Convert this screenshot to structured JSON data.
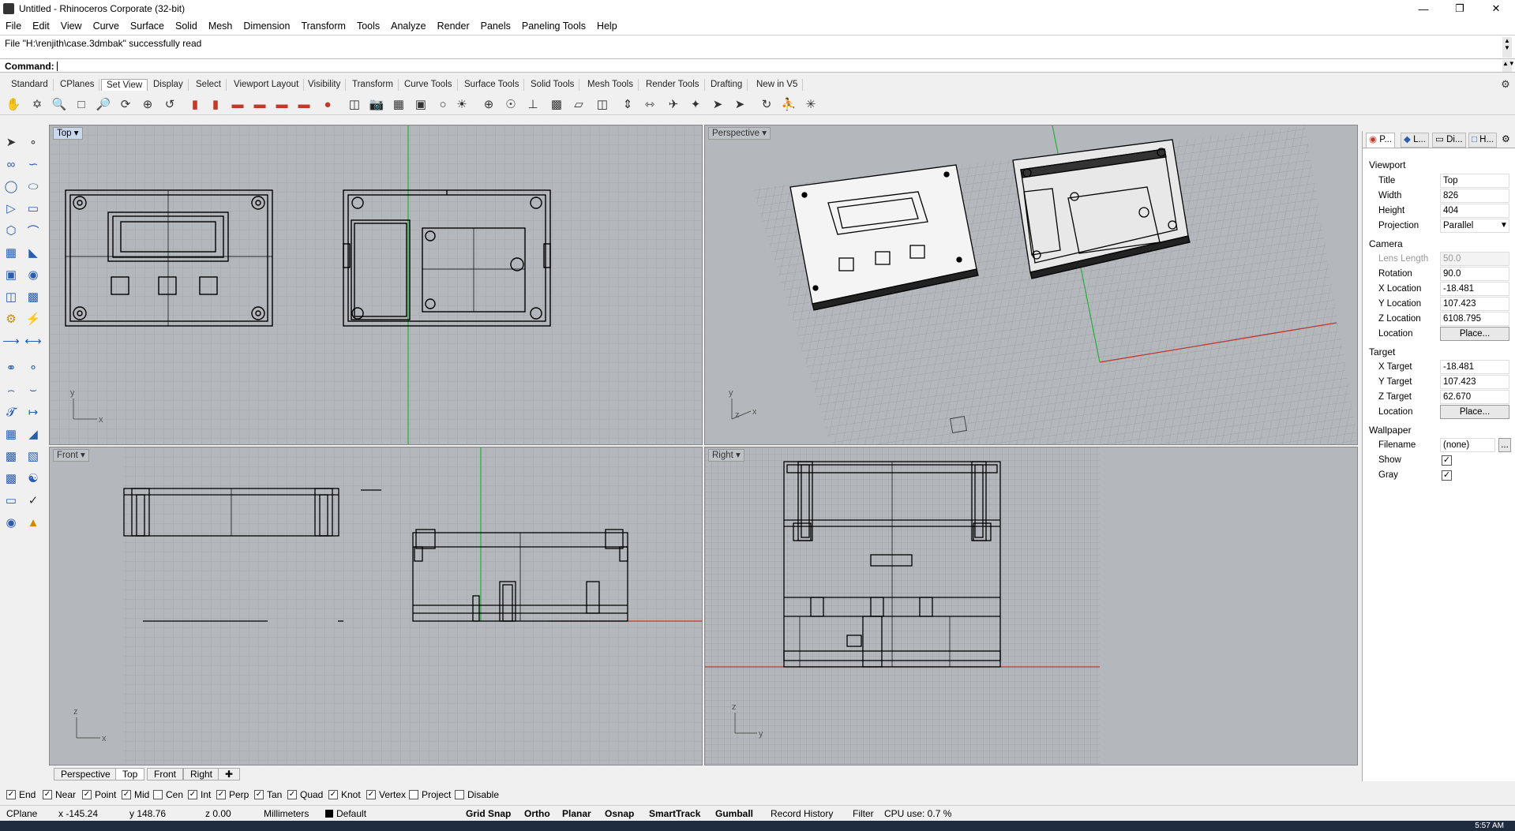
{
  "window": {
    "title": "Untitled - Rhinoceros Corporate (32-bit)"
  },
  "menu": [
    "File",
    "Edit",
    "View",
    "Curve",
    "Surface",
    "Solid",
    "Mesh",
    "Dimension",
    "Transform",
    "Tools",
    "Analyze",
    "Render",
    "Panels",
    "Paneling Tools",
    "Help"
  ],
  "command": {
    "history": "File \"H:\\renjith\\case.3dmbak\" successfully read",
    "prompt": "Command:"
  },
  "toolbar_tabs": [
    "Standard",
    "CPlanes",
    "Set View",
    "Display",
    "Select",
    "Viewport Layout",
    "Visibility",
    "Transform",
    "Curve Tools",
    "Surface Tools",
    "Solid Tools",
    "Mesh Tools",
    "Render Tools",
    "Drafting",
    "New in V5"
  ],
  "active_toolbar_tab": "Set View",
  "viewports": {
    "top": {
      "label": "Top"
    },
    "perspective": {
      "label": "Perspective"
    },
    "front": {
      "label": "Front"
    },
    "right": {
      "label": "Right"
    }
  },
  "viewport_tabs": [
    "Perspective",
    "Top",
    "Front",
    "Right"
  ],
  "axis_labels": {
    "x": "x",
    "y": "y",
    "z": "z"
  },
  "panel": {
    "tabs": [
      "P...",
      "L...",
      "Di...",
      "H..."
    ],
    "viewport_section": "Viewport",
    "title_label": "Title",
    "title_value": "Top",
    "width_label": "Width",
    "width_value": "826",
    "height_label": "Height",
    "height_value": "404",
    "projection_label": "Projection",
    "projection_value": "Parallel",
    "camera_section": "Camera",
    "lens_label": "Lens Length",
    "lens_value": "50.0",
    "rotation_label": "Rotation",
    "rotation_value": "90.0",
    "xloc_label": "X Location",
    "xloc_value": "-18.481",
    "yloc_label": "Y Location",
    "yloc_value": "107.423",
    "zloc_label": "Z Location",
    "zloc_value": "6108.795",
    "location_label": "Location",
    "place_button": "Place...",
    "target_section": "Target",
    "xt_label": "X Target",
    "xt_value": "-18.481",
    "yt_label": "Y Target",
    "yt_value": "107.423",
    "zt_label": "Z Target",
    "zt_value": "62.670",
    "tlocation_label": "Location",
    "tplace_button": "Place...",
    "wallpaper_section": "Wallpaper",
    "filename_label": "Filename",
    "filename_value": "(none)",
    "browse_button": "...",
    "show_label": "Show",
    "gray_label": "Gray"
  },
  "osnaps": [
    {
      "label": "End",
      "checked": true
    },
    {
      "label": "Near",
      "checked": true
    },
    {
      "label": "Point",
      "checked": true
    },
    {
      "label": "Mid",
      "checked": true
    },
    {
      "label": "Cen",
      "checked": false
    },
    {
      "label": "Int",
      "checked": true
    },
    {
      "label": "Perp",
      "checked": true
    },
    {
      "label": "Tan",
      "checked": true
    },
    {
      "label": "Quad",
      "checked": true
    },
    {
      "label": "Knot",
      "checked": true
    },
    {
      "label": "Vertex",
      "checked": true
    },
    {
      "label": "Project",
      "checked": false
    },
    {
      "label": "Disable",
      "checked": false
    }
  ],
  "status": {
    "cplane": "CPlane",
    "x": "x -145.24",
    "y": "y 148.76",
    "z": "z 0.00",
    "units": "Millimeters",
    "layer": "Default",
    "grid_snap": "Grid Snap",
    "ortho": "Ortho",
    "planar": "Planar",
    "osnap": "Osnap",
    "smarttrack": "SmartTrack",
    "gumball": "Gumball",
    "record_history": "Record History",
    "filter": "Filter",
    "cpu": "CPU use: 0.7 %"
  },
  "taskbar": {
    "clock": "5:57 AM"
  },
  "colors": {
    "viewport_bg": "#b4b8bc",
    "x_axis": "#c0392b",
    "y_axis": "#27ae3c",
    "active_label": "#c9d8ec"
  }
}
